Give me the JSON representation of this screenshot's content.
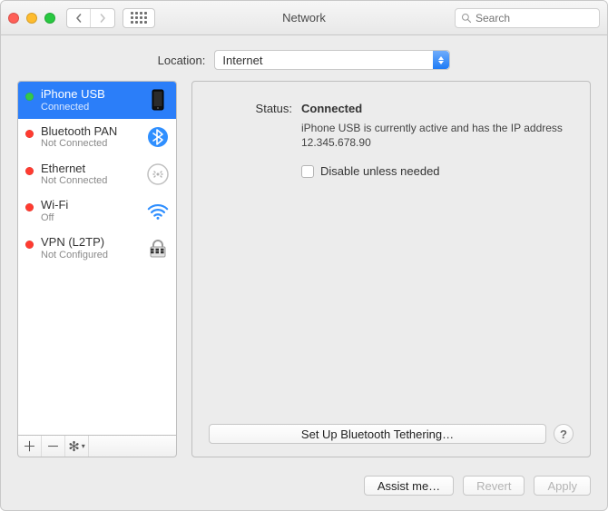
{
  "titlebar": {
    "title": "Network",
    "search_placeholder": "Search"
  },
  "location": {
    "label": "Location:",
    "value": "Internet"
  },
  "services": [
    {
      "name": "iPhone USB",
      "status": "Connected",
      "dot": "green",
      "icon": "iphone-icon",
      "selected": true
    },
    {
      "name": "Bluetooth PAN",
      "status": "Not Connected",
      "dot": "red",
      "icon": "bluetooth-icon",
      "selected": false
    },
    {
      "name": "Ethernet",
      "status": "Not Connected",
      "dot": "red",
      "icon": "ethernet-icon",
      "selected": false
    },
    {
      "name": "Wi-Fi",
      "status": "Off",
      "dot": "red",
      "icon": "wifi-icon",
      "selected": false
    },
    {
      "name": "VPN (L2TP)",
      "status": "Not Configured",
      "dot": "red",
      "icon": "vpn-icon",
      "selected": false
    }
  ],
  "sidebar_tools": {
    "add_label": "+",
    "remove_label": "−",
    "gear_label": "✲"
  },
  "detail": {
    "status_label": "Status:",
    "status_value": "Connected",
    "description": "iPhone USB is currently active and has the IP address 12.345.678.90",
    "checkbox_label": "Disable unless needed",
    "setup_button": "Set Up Bluetooth Tethering…",
    "help_label": "?"
  },
  "footer": {
    "assist": "Assist me…",
    "revert": "Revert",
    "apply": "Apply"
  }
}
